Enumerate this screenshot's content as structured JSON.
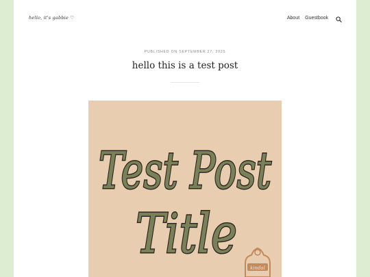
{
  "site": {
    "logo": "hello, it's gabbie ♡"
  },
  "nav": {
    "items": [
      "About",
      "Guestbook"
    ]
  },
  "post": {
    "published_label": "PUBLISHED ON",
    "published_date": "SEPTEMBER 27, 2025",
    "title": "hello this is a test post"
  },
  "hero": {
    "line1": "Test Post",
    "line2": "Title",
    "badge_text": "kindal"
  },
  "colors": {
    "page_bg": "#dcedd2",
    "hero_bg": "#e8cdb0",
    "hero_text": "#7a8158",
    "hero_outline": "#2e2620",
    "badge": "#c28a5d"
  }
}
